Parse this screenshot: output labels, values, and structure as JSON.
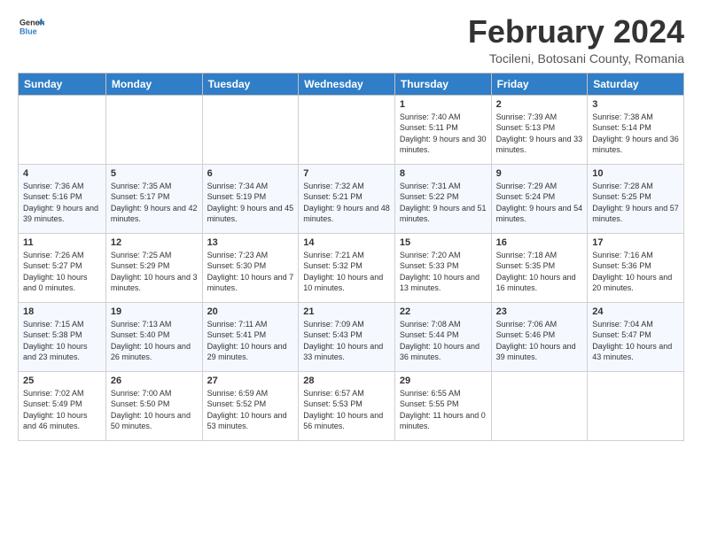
{
  "header": {
    "logo_general": "General",
    "logo_blue": "Blue",
    "month_title": "February 2024",
    "subtitle": "Tocileni, Botosani County, Romania"
  },
  "days_of_week": [
    "Sunday",
    "Monday",
    "Tuesday",
    "Wednesday",
    "Thursday",
    "Friday",
    "Saturday"
  ],
  "weeks": [
    [
      {
        "num": "",
        "info": ""
      },
      {
        "num": "",
        "info": ""
      },
      {
        "num": "",
        "info": ""
      },
      {
        "num": "",
        "info": ""
      },
      {
        "num": "1",
        "info": "Sunrise: 7:40 AM\nSunset: 5:11 PM\nDaylight: 9 hours and 30 minutes."
      },
      {
        "num": "2",
        "info": "Sunrise: 7:39 AM\nSunset: 5:13 PM\nDaylight: 9 hours and 33 minutes."
      },
      {
        "num": "3",
        "info": "Sunrise: 7:38 AM\nSunset: 5:14 PM\nDaylight: 9 hours and 36 minutes."
      }
    ],
    [
      {
        "num": "4",
        "info": "Sunrise: 7:36 AM\nSunset: 5:16 PM\nDaylight: 9 hours and 39 minutes."
      },
      {
        "num": "5",
        "info": "Sunrise: 7:35 AM\nSunset: 5:17 PM\nDaylight: 9 hours and 42 minutes."
      },
      {
        "num": "6",
        "info": "Sunrise: 7:34 AM\nSunset: 5:19 PM\nDaylight: 9 hours and 45 minutes."
      },
      {
        "num": "7",
        "info": "Sunrise: 7:32 AM\nSunset: 5:21 PM\nDaylight: 9 hours and 48 minutes."
      },
      {
        "num": "8",
        "info": "Sunrise: 7:31 AM\nSunset: 5:22 PM\nDaylight: 9 hours and 51 minutes."
      },
      {
        "num": "9",
        "info": "Sunrise: 7:29 AM\nSunset: 5:24 PM\nDaylight: 9 hours and 54 minutes."
      },
      {
        "num": "10",
        "info": "Sunrise: 7:28 AM\nSunset: 5:25 PM\nDaylight: 9 hours and 57 minutes."
      }
    ],
    [
      {
        "num": "11",
        "info": "Sunrise: 7:26 AM\nSunset: 5:27 PM\nDaylight: 10 hours and 0 minutes."
      },
      {
        "num": "12",
        "info": "Sunrise: 7:25 AM\nSunset: 5:29 PM\nDaylight: 10 hours and 3 minutes."
      },
      {
        "num": "13",
        "info": "Sunrise: 7:23 AM\nSunset: 5:30 PM\nDaylight: 10 hours and 7 minutes."
      },
      {
        "num": "14",
        "info": "Sunrise: 7:21 AM\nSunset: 5:32 PM\nDaylight: 10 hours and 10 minutes."
      },
      {
        "num": "15",
        "info": "Sunrise: 7:20 AM\nSunset: 5:33 PM\nDaylight: 10 hours and 13 minutes."
      },
      {
        "num": "16",
        "info": "Sunrise: 7:18 AM\nSunset: 5:35 PM\nDaylight: 10 hours and 16 minutes."
      },
      {
        "num": "17",
        "info": "Sunrise: 7:16 AM\nSunset: 5:36 PM\nDaylight: 10 hours and 20 minutes."
      }
    ],
    [
      {
        "num": "18",
        "info": "Sunrise: 7:15 AM\nSunset: 5:38 PM\nDaylight: 10 hours and 23 minutes."
      },
      {
        "num": "19",
        "info": "Sunrise: 7:13 AM\nSunset: 5:40 PM\nDaylight: 10 hours and 26 minutes."
      },
      {
        "num": "20",
        "info": "Sunrise: 7:11 AM\nSunset: 5:41 PM\nDaylight: 10 hours and 29 minutes."
      },
      {
        "num": "21",
        "info": "Sunrise: 7:09 AM\nSunset: 5:43 PM\nDaylight: 10 hours and 33 minutes."
      },
      {
        "num": "22",
        "info": "Sunrise: 7:08 AM\nSunset: 5:44 PM\nDaylight: 10 hours and 36 minutes."
      },
      {
        "num": "23",
        "info": "Sunrise: 7:06 AM\nSunset: 5:46 PM\nDaylight: 10 hours and 39 minutes."
      },
      {
        "num": "24",
        "info": "Sunrise: 7:04 AM\nSunset: 5:47 PM\nDaylight: 10 hours and 43 minutes."
      }
    ],
    [
      {
        "num": "25",
        "info": "Sunrise: 7:02 AM\nSunset: 5:49 PM\nDaylight: 10 hours and 46 minutes."
      },
      {
        "num": "26",
        "info": "Sunrise: 7:00 AM\nSunset: 5:50 PM\nDaylight: 10 hours and 50 minutes."
      },
      {
        "num": "27",
        "info": "Sunrise: 6:59 AM\nSunset: 5:52 PM\nDaylight: 10 hours and 53 minutes."
      },
      {
        "num": "28",
        "info": "Sunrise: 6:57 AM\nSunset: 5:53 PM\nDaylight: 10 hours and 56 minutes."
      },
      {
        "num": "29",
        "info": "Sunrise: 6:55 AM\nSunset: 5:55 PM\nDaylight: 11 hours and 0 minutes."
      },
      {
        "num": "",
        "info": ""
      },
      {
        "num": "",
        "info": ""
      }
    ]
  ]
}
